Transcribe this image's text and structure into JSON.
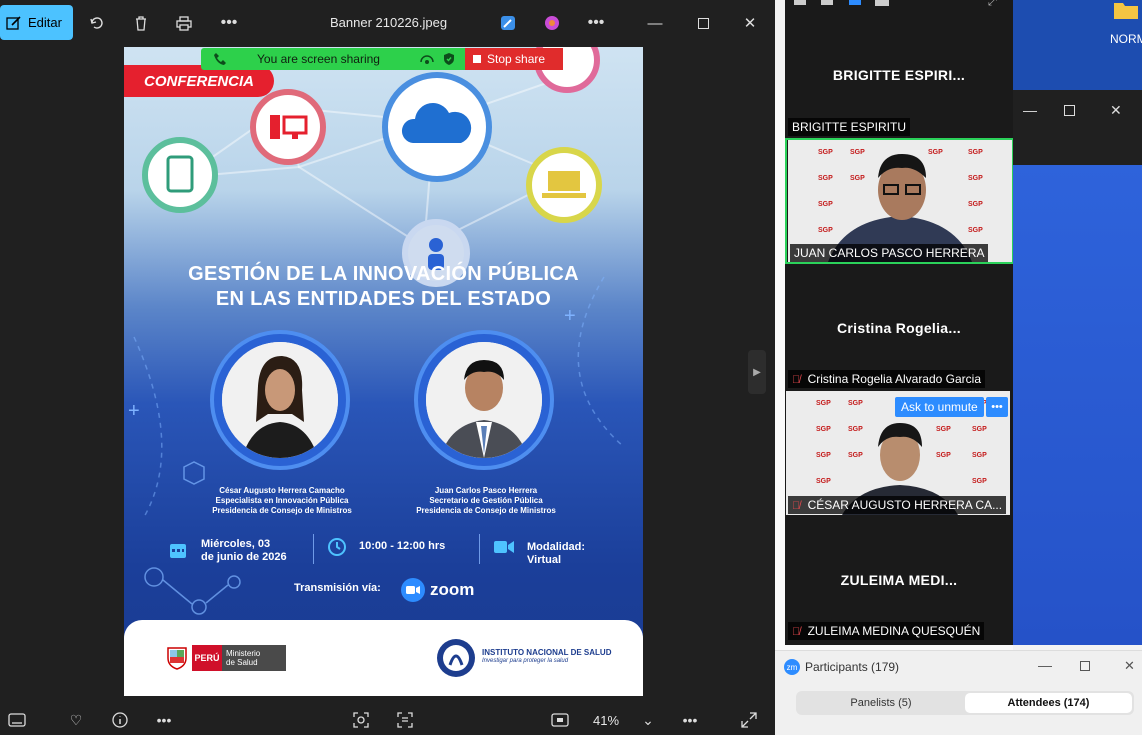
{
  "photos_app": {
    "edit_label": "Editar",
    "file_title": "Banner 210226.jpeg",
    "zoom_level": "41%"
  },
  "banner": {
    "tag": "CONFERENCIA",
    "title_line1": "GESTIÓN DE LA INNOVACIÓN PÚBLICA",
    "title_line2": "EN LAS ENTIDADES DEL ESTADO",
    "speakers": [
      {
        "name": "César Augusto Herrera Camacho",
        "role": "Especialista en Innovación Pública",
        "org": "Presidencia de Consejo de Ministros"
      },
      {
        "name": "Juan Carlos Pasco Herrera",
        "role": "Secretario de Gestión Pública",
        "org": "Presidencia de Consejo de Ministros"
      }
    ],
    "date_line1": "Miércoles, 03",
    "date_line2": "de junio de 2026",
    "time": "10:00 - 12:00 hrs",
    "mode_line1": "Modalidad:",
    "mode_line2": "Virtual",
    "transmission": "Transmisión vía:",
    "platform": "zoom",
    "footer_left_badge": "PERÚ",
    "footer_left_line1": "Ministerio",
    "footer_left_line2": "de Salud",
    "footer_right_title": "INSTITUTO NACIONAL DE SALUD",
    "footer_right_sub": "Investigar para proteger la salud"
  },
  "share_bar": {
    "status": "You are screen sharing",
    "stop": "Stop share"
  },
  "gallery": {
    "tiles": [
      {
        "big_name": "BRIGITTE  ESPIRI...",
        "label": "BRIGITTE ESPIRITU"
      },
      {
        "label": "JUAN CARLOS PASCO HERRERA"
      },
      {
        "big_name": "Cristina  Rogelia...",
        "label": "Cristina Rogelia Alvarado Garcia"
      },
      {
        "label": "CÉSAR AUGUSTO HERRERA CA...",
        "ask_unmute": "Ask to unmute"
      },
      {
        "big_name": "ZULEIMA  MEDI...",
        "label": "ZULEIMA MEDINA QUESQUÉN"
      }
    ],
    "sgp_text": "SGP"
  },
  "desktop": {
    "corner_text": "NORM"
  },
  "participants": {
    "badge": "zm",
    "title": "Participants (179)",
    "tab_panelists": "Panelists (5)",
    "tab_attendees": "Attendees (174)"
  },
  "colors": {
    "accent": "#4cc2ff",
    "share_green": "#2dd04b",
    "stop_red": "#e02c2c",
    "active_speaker_border": "#2bd25a"
  }
}
